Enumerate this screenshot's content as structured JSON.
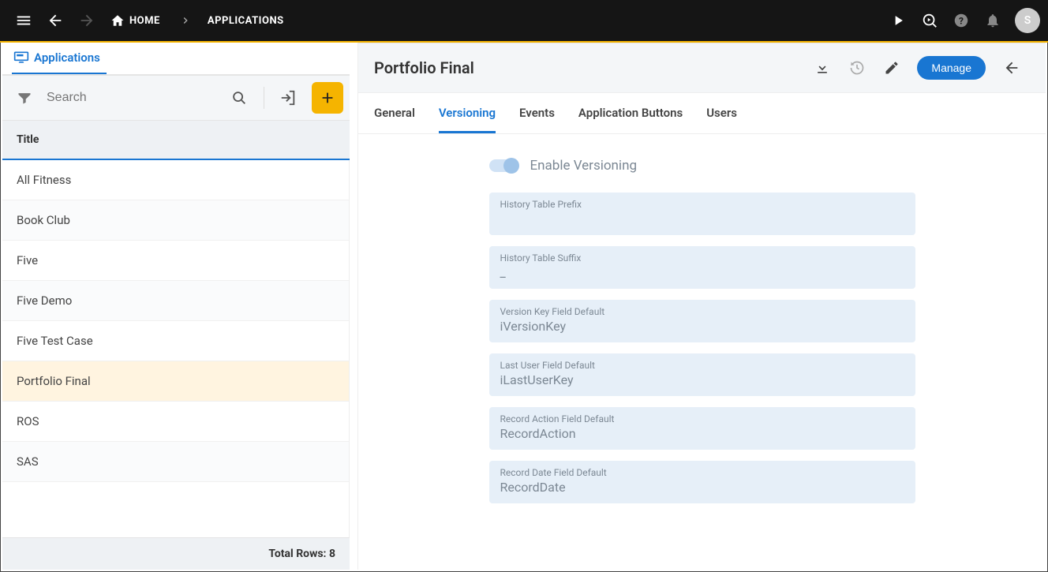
{
  "topbar": {
    "home": "HOME",
    "crumb1": "APPLICATIONS",
    "avatar_letter": "S"
  },
  "left": {
    "tab_label": "Applications",
    "search_placeholder": "Search",
    "title_header": "Title",
    "items": [
      {
        "label": "All Fitness"
      },
      {
        "label": "Book Club"
      },
      {
        "label": "Five"
      },
      {
        "label": "Five Demo"
      },
      {
        "label": "Five Test Case"
      },
      {
        "label": "Portfolio Final"
      },
      {
        "label": "ROS"
      },
      {
        "label": "SAS"
      }
    ],
    "selected_index": 5,
    "footer": "Total Rows: 8"
  },
  "right": {
    "title": "Portfolio Final",
    "manage_button": "Manage",
    "tabs": [
      {
        "label": "General"
      },
      {
        "label": "Versioning"
      },
      {
        "label": "Events"
      },
      {
        "label": "Application Buttons"
      },
      {
        "label": "Users"
      }
    ],
    "active_tab_index": 1,
    "toggle_label": "Enable Versioning",
    "fields": [
      {
        "label": "History Table Prefix",
        "value": ""
      },
      {
        "label": "History Table Suffix",
        "value": "_"
      },
      {
        "label": "Version Key Field Default",
        "value": "iVersionKey"
      },
      {
        "label": "Last User Field Default",
        "value": "iLastUserKey"
      },
      {
        "label": "Record Action Field Default",
        "value": "RecordAction"
      },
      {
        "label": "Record Date Field Default",
        "value": "RecordDate"
      }
    ]
  }
}
